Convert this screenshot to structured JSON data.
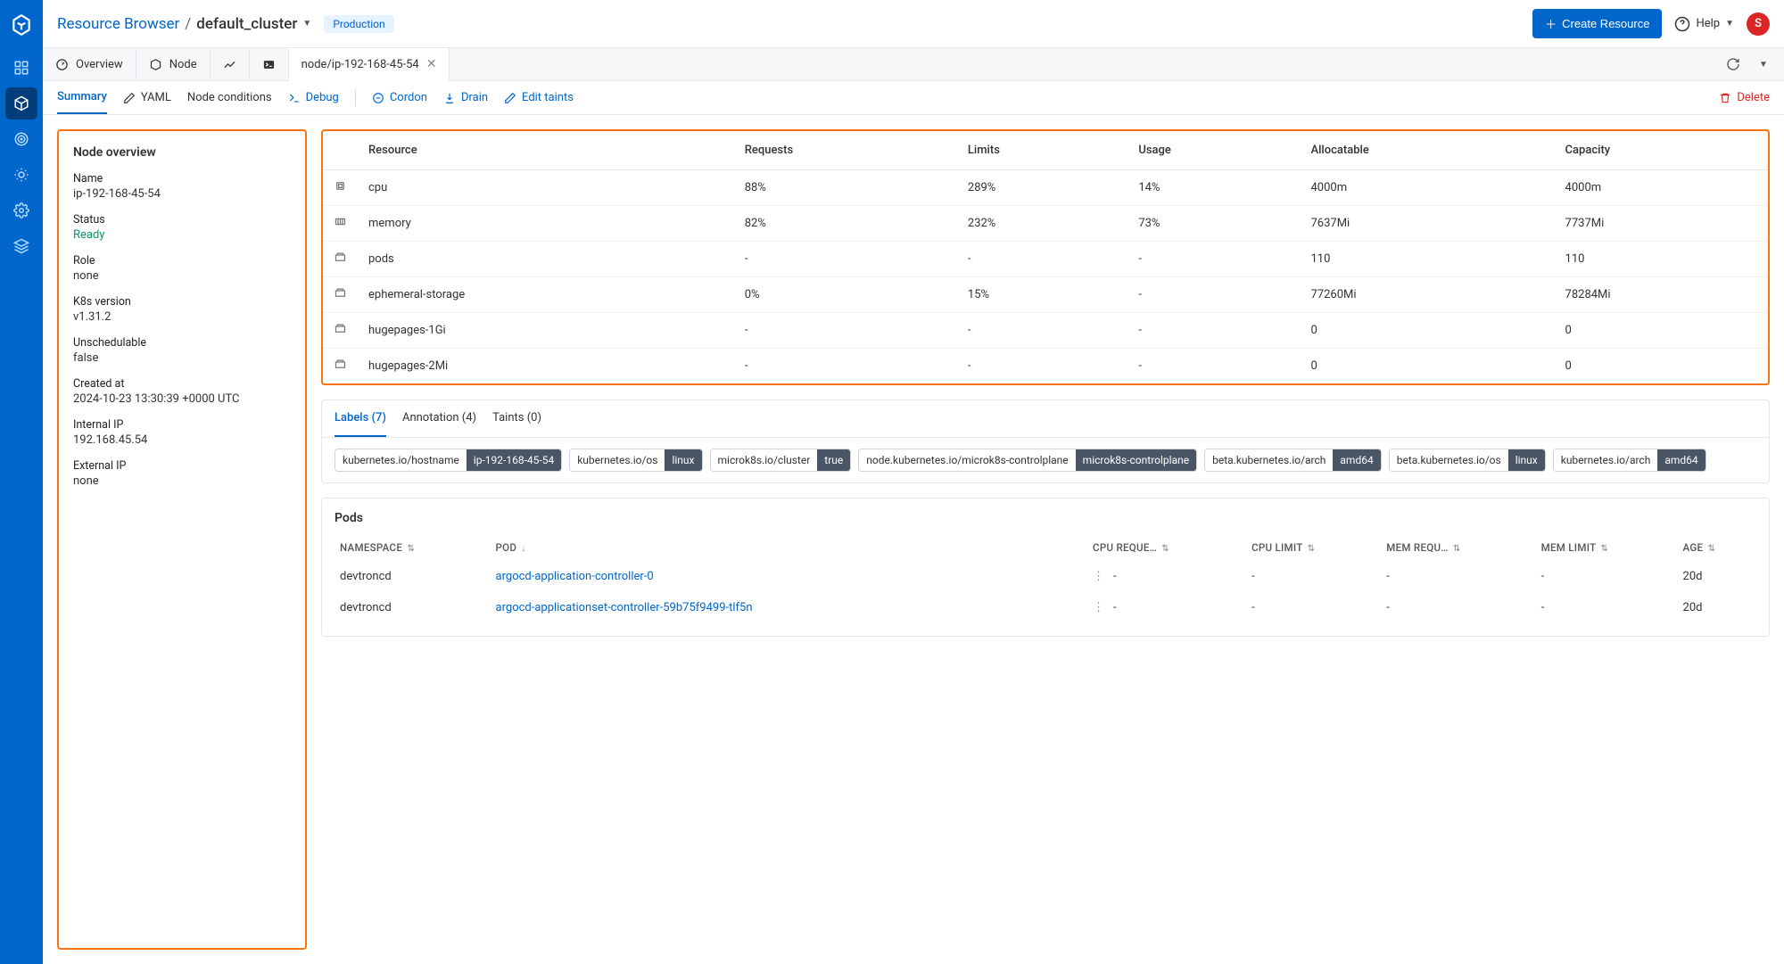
{
  "breadcrumb": {
    "root": "Resource Browser",
    "cluster": "default_cluster"
  },
  "env_badge": "Production",
  "header": {
    "create_btn": "Create Resource",
    "help": "Help",
    "avatar": "S"
  },
  "tabs": {
    "overview": "Overview",
    "node": "Node",
    "active": "node/ip-192-168-45-54"
  },
  "subtabs": {
    "summary": "Summary",
    "yaml": "YAML",
    "conditions": "Node conditions",
    "debug": "Debug",
    "cordon": "Cordon",
    "drain": "Drain",
    "edit_taints": "Edit taints",
    "delete": "Delete"
  },
  "overview": {
    "title": "Node overview",
    "fields": [
      {
        "label": "Name",
        "value": "ip-192-168-45-54"
      },
      {
        "label": "Status",
        "value": "Ready",
        "cls": "ready"
      },
      {
        "label": "Role",
        "value": "none"
      },
      {
        "label": "K8s version",
        "value": "v1.31.2"
      },
      {
        "label": "Unschedulable",
        "value": "false"
      },
      {
        "label": "Created at",
        "value": "2024-10-23 13:30:39 +0000 UTC"
      },
      {
        "label": "Internal IP",
        "value": "192.168.45.54"
      },
      {
        "label": "External IP",
        "value": "none"
      }
    ]
  },
  "resTable": {
    "headers": [
      "Resource",
      "Requests",
      "Limits",
      "Usage",
      "Allocatable",
      "Capacity"
    ],
    "rows": [
      {
        "name": "cpu",
        "req": "88%",
        "lim": "289%",
        "use": "14%",
        "alloc": "4000m",
        "cap": "4000m"
      },
      {
        "name": "memory",
        "req": "82%",
        "lim": "232%",
        "use": "73%",
        "alloc": "7637Mi",
        "cap": "7737Mi"
      },
      {
        "name": "pods",
        "req": "-",
        "lim": "-",
        "use": "-",
        "alloc": "110",
        "cap": "110"
      },
      {
        "name": "ephemeral-storage",
        "req": "0%",
        "lim": "15%",
        "use": "-",
        "alloc": "77260Mi",
        "cap": "78284Mi"
      },
      {
        "name": "hugepages-1Gi",
        "req": "-",
        "lim": "-",
        "use": "-",
        "alloc": "0",
        "cap": "0"
      },
      {
        "name": "hugepages-2Mi",
        "req": "-",
        "lim": "-",
        "use": "-",
        "alloc": "0",
        "cap": "0"
      }
    ]
  },
  "metaTabs": {
    "labels": "Labels (7)",
    "annotation": "Annotation (4)",
    "taints": "Taints (0)"
  },
  "labels": [
    {
      "k": "kubernetes.io/hostname",
      "v": "ip-192-168-45-54"
    },
    {
      "k": "kubernetes.io/os",
      "v": "linux"
    },
    {
      "k": "microk8s.io/cluster",
      "v": "true"
    },
    {
      "k": "node.kubernetes.io/microk8s-controlplane",
      "v": "microk8s-controlplane"
    },
    {
      "k": "beta.kubernetes.io/arch",
      "v": "amd64"
    },
    {
      "k": "beta.kubernetes.io/os",
      "v": "linux"
    },
    {
      "k": "kubernetes.io/arch",
      "v": "amd64"
    }
  ],
  "pods": {
    "title": "Pods",
    "headers": {
      "ns": "NAMESPACE",
      "pod": "POD",
      "cpureq": "CPU REQUE…",
      "cpulim": "CPU LIMIT",
      "memreq": "MEM REQU…",
      "memlim": "MEM LIMIT",
      "age": "AGE"
    },
    "rows": [
      {
        "ns": "devtroncd",
        "pod": "argocd-application-controller-0",
        "cpureq": "-",
        "cpulim": "-",
        "memreq": "-",
        "memlim": "-",
        "age": "20d"
      },
      {
        "ns": "devtroncd",
        "pod": "argocd-applicationset-controller-59b75f9499-tlf5n",
        "cpureq": "-",
        "cpulim": "-",
        "memreq": "-",
        "memlim": "-",
        "age": "20d"
      }
    ]
  }
}
